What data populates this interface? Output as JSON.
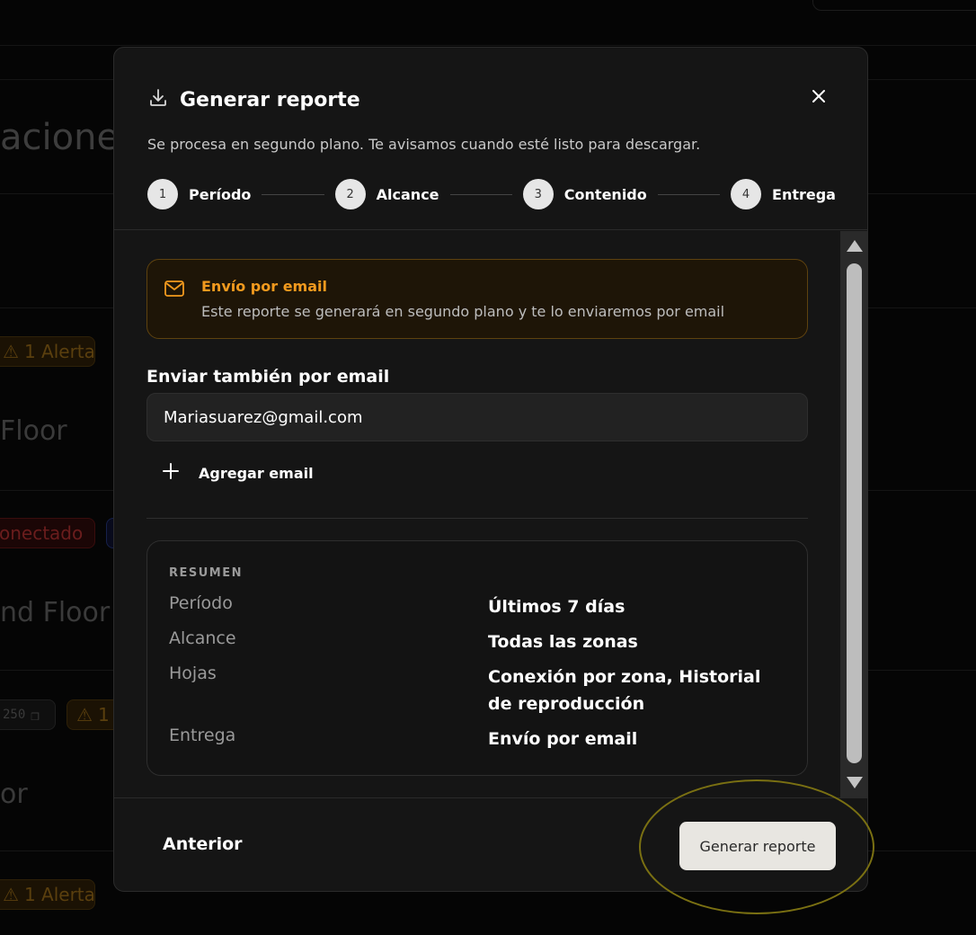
{
  "background": {
    "title_fragment": "acione",
    "rows": [
      {
        "alert": "1 Alerta",
        "name": "Floor"
      },
      {
        "status": "onectado",
        "name": "nd Floor"
      },
      {
        "code": "250",
        "alert_fragment": "1",
        "name": "or"
      },
      {
        "alert": "1 Alerta"
      }
    ]
  },
  "modal": {
    "title": "Generar reporte",
    "subtitle": "Se procesa en segundo plano. Te avisamos cuando esté listo para descargar.",
    "steps": [
      {
        "num": "1",
        "label": "Período"
      },
      {
        "num": "2",
        "label": "Alcance"
      },
      {
        "num": "3",
        "label": "Contenido"
      },
      {
        "num": "4",
        "label": "Entrega"
      }
    ],
    "info": {
      "title": "Envío por email",
      "text": "Este reporte se generará en segundo plano y te lo enviaremos por email"
    },
    "email": {
      "label": "Enviar también por email",
      "value": "Mariasuarez@gmail.com",
      "add_label": "Agregar email"
    },
    "summary": {
      "heading": "RESUMEN",
      "rows": [
        {
          "key": "Período",
          "value": "Últimos 7 días"
        },
        {
          "key": "Alcance",
          "value": "Todas las zonas"
        },
        {
          "key": "Hojas",
          "value": "Conexión por zona, Historial de reproducción"
        },
        {
          "key": "Entrega",
          "value": "Envío por email"
        }
      ]
    },
    "footer": {
      "prev_label": "Anterior",
      "generate_label": "Generar reporte"
    }
  },
  "colors": {
    "accent_orange": "#f29a1e",
    "modal_bg": "#151515",
    "highlight": "#7a7012"
  }
}
